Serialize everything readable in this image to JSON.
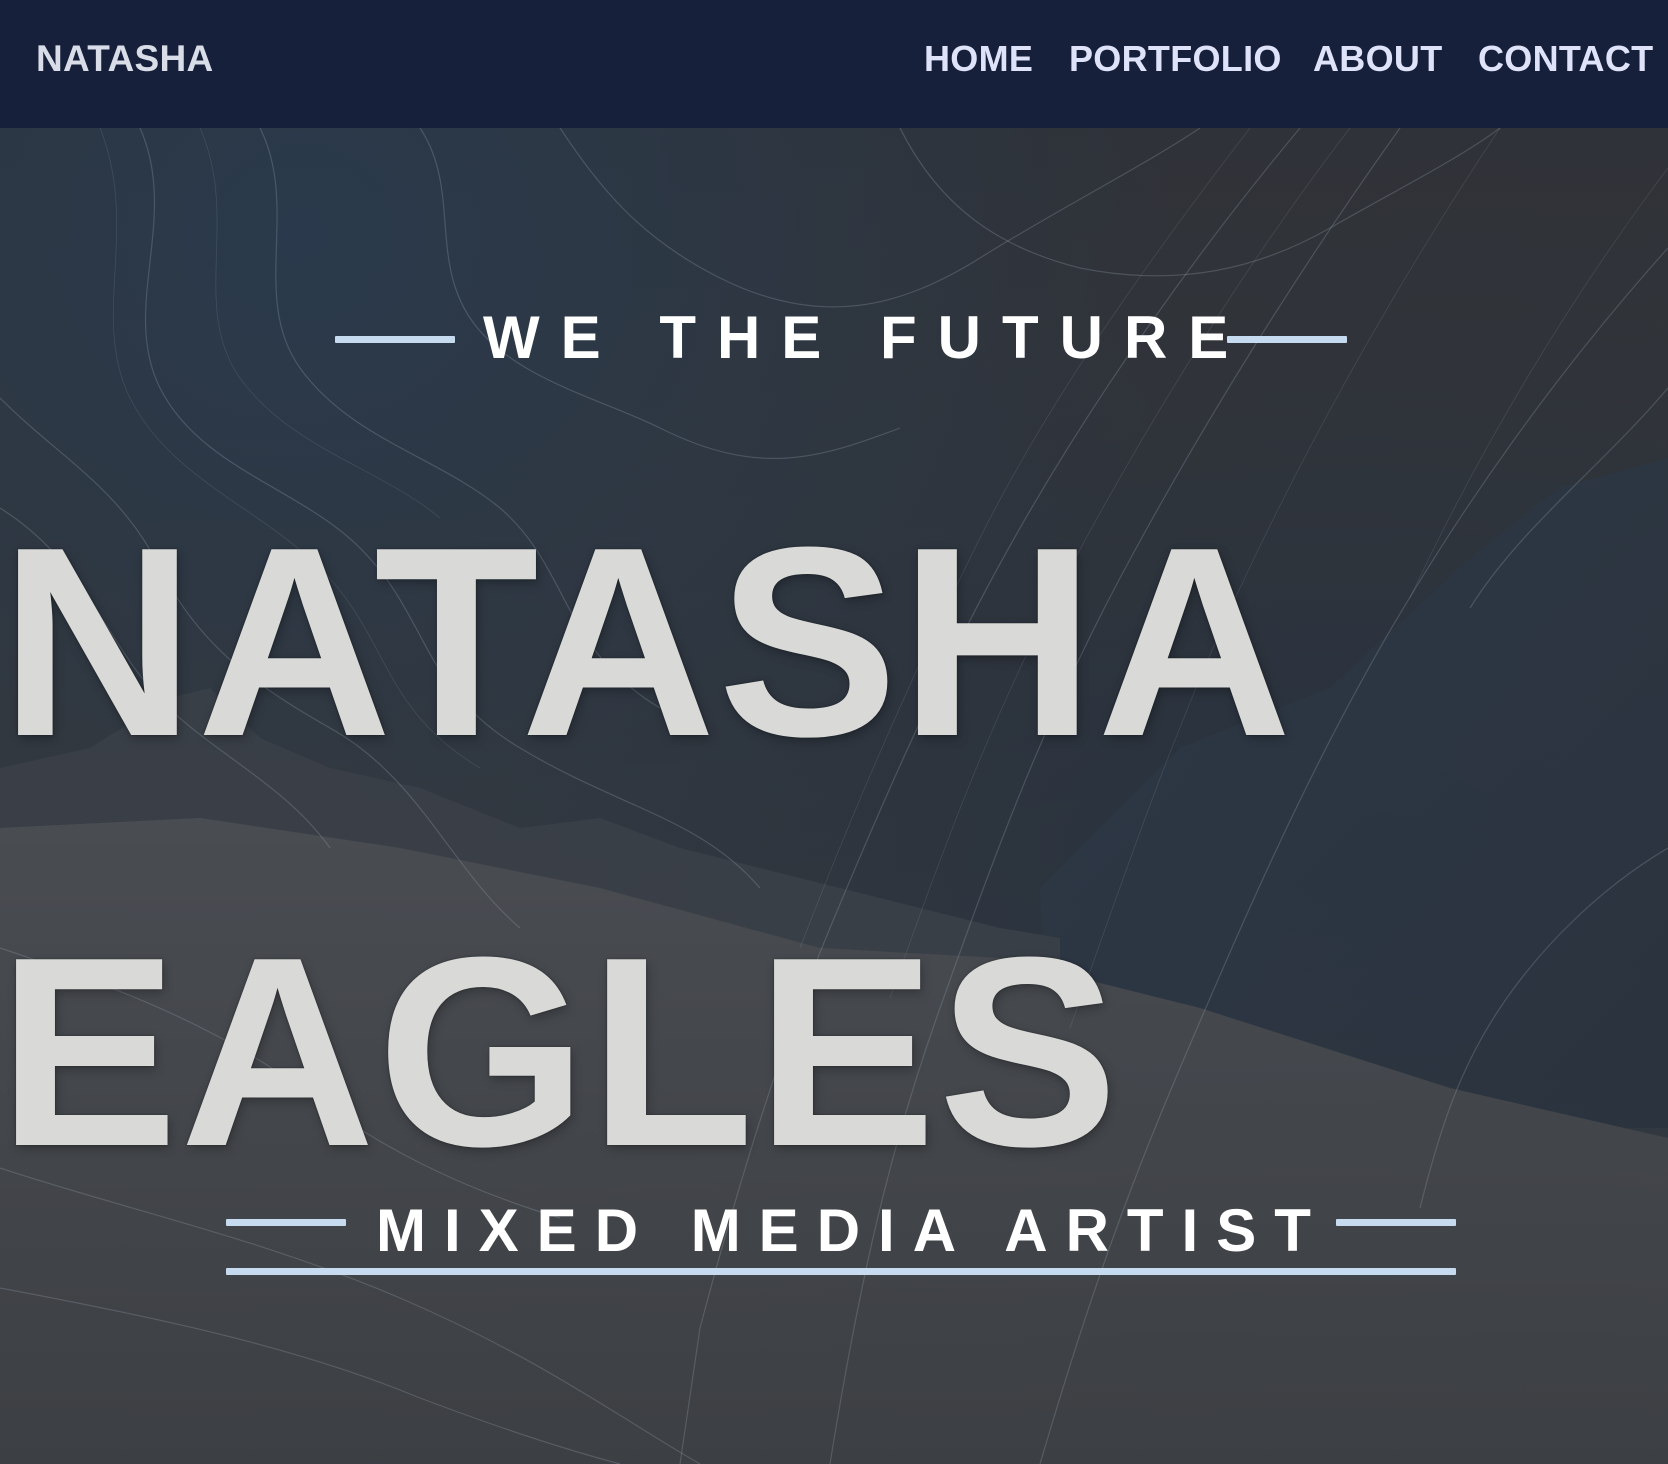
{
  "navbar": {
    "brand": "NATASHA",
    "links": [
      "HOME",
      "PORTFOLIO",
      "ABOUT",
      "CONTACT"
    ]
  },
  "hero": {
    "tagline": "WE THE FUTURE",
    "name_first": "NATASHA",
    "name_last": "EAGLES",
    "subtitle": "MIXED MEDIA ARTIST"
  },
  "colors": {
    "navbar_bg": "#16203a",
    "nav_text": "#dfe3f9",
    "accent_line": "#c6dbef",
    "hero_text": "#d9dad7"
  }
}
